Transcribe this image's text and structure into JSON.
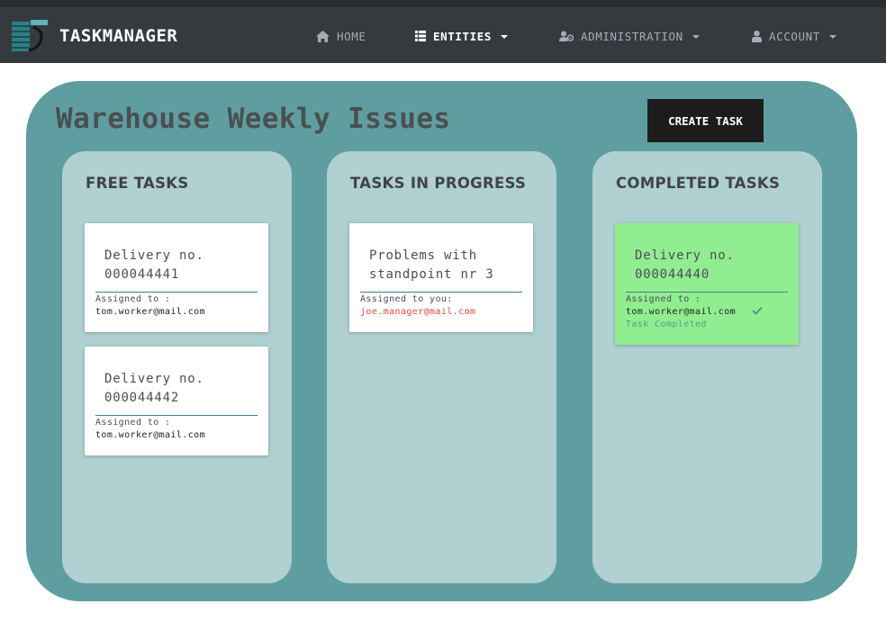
{
  "app": {
    "title": "TASKMANAGER"
  },
  "nav": {
    "home": "HOME",
    "entities": "ENTITIES",
    "administration": "ADMINISTRATION",
    "account": "ACCOUNT"
  },
  "board": {
    "title": "Warehouse Weekly Issues",
    "create_label": "CREATE TASK"
  },
  "columns": [
    {
      "title": "FREE TASKS",
      "cards": [
        {
          "title": "Delivery no. 000044441",
          "assigned_label": "Assigned to :",
          "email": "tom.worker@mail.com"
        },
        {
          "title": "Delivery no. 000044442",
          "assigned_label": "Assigned to :",
          "email": "tom.worker@mail.com"
        }
      ]
    },
    {
      "title": "TASKS IN PROGRESS",
      "cards": [
        {
          "title": "Problems with standpoint nr 3",
          "assigned_label": "Assigned to you:",
          "email": "joe.manager@mail.com"
        }
      ]
    },
    {
      "title": "COMPLETED TASKS",
      "cards": [
        {
          "title": "Delivery no. 000044440",
          "assigned_label": "Assigned to :",
          "email": "tom.worker@mail.com",
          "status": "Task Completed"
        }
      ]
    }
  ],
  "colors": {
    "navbar": "#353a3f",
    "board": "#5f9ea0",
    "column": "#b0d0d2",
    "completed_card": "#90ee90",
    "self_assigned": "#e8453c"
  }
}
